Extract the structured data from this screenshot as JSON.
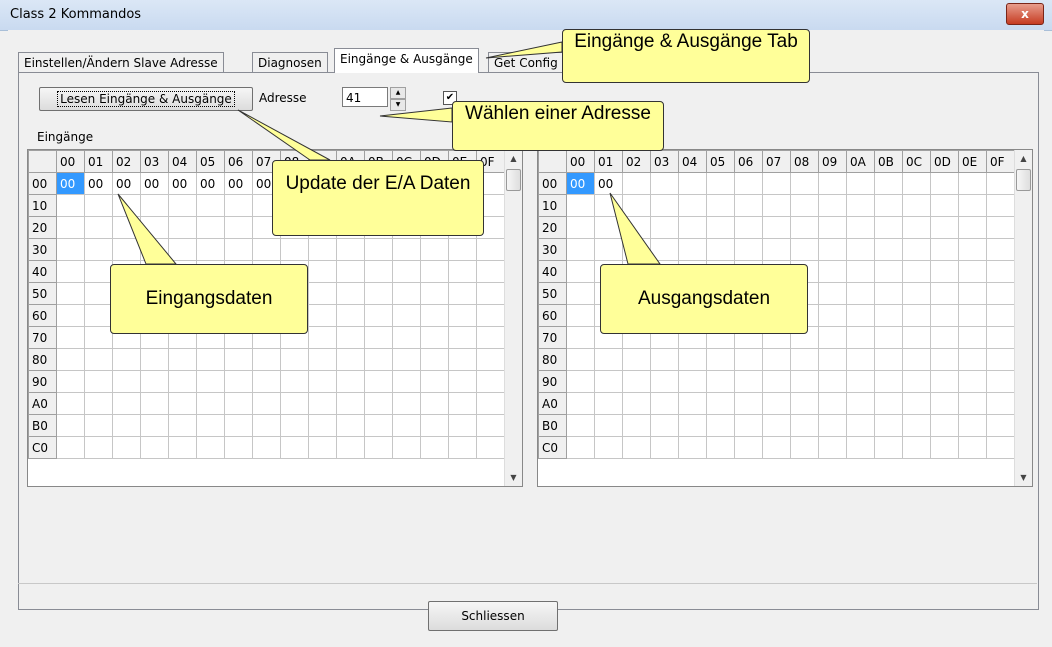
{
  "window": {
    "title": "Class 2 Kommandos",
    "close_glyph": "x"
  },
  "tabs": [
    {
      "label": "Einstellen/Ändern Slave Adresse"
    },
    {
      "label": "Diagnosen"
    },
    {
      "label": "Eingänge & Ausgänge"
    },
    {
      "label": "Get Config"
    }
  ],
  "toolbar": {
    "read_button": "Lesen Eingänge & Ausgänge",
    "address_label": "Adresse",
    "address_value": "41"
  },
  "inputs_label": "Eingänge",
  "columns": [
    "00",
    "01",
    "02",
    "03",
    "04",
    "05",
    "06",
    "07",
    "08",
    "09",
    "0A",
    "0B",
    "0C",
    "0D",
    "0E",
    "0F"
  ],
  "rows": [
    "00",
    "10",
    "20",
    "30",
    "40",
    "50",
    "60",
    "70",
    "80",
    "90",
    "A0",
    "B0",
    "C0"
  ],
  "inputs_row0": [
    "00",
    "00",
    "00",
    "00",
    "00",
    "00",
    "00",
    "00"
  ],
  "outputs_row0": [
    "00",
    "00"
  ],
  "close_button": "Schliessen",
  "callouts": {
    "tab": "Eingänge & Ausgänge Tab",
    "address": "Wählen einer Adresse",
    "update": "Update der E/A Daten",
    "inputs": "Eingangsdaten",
    "outputs": "Ausgangsdaten"
  },
  "colors": {
    "callout_fill": "#ffff99",
    "selection": "#3399ff"
  }
}
